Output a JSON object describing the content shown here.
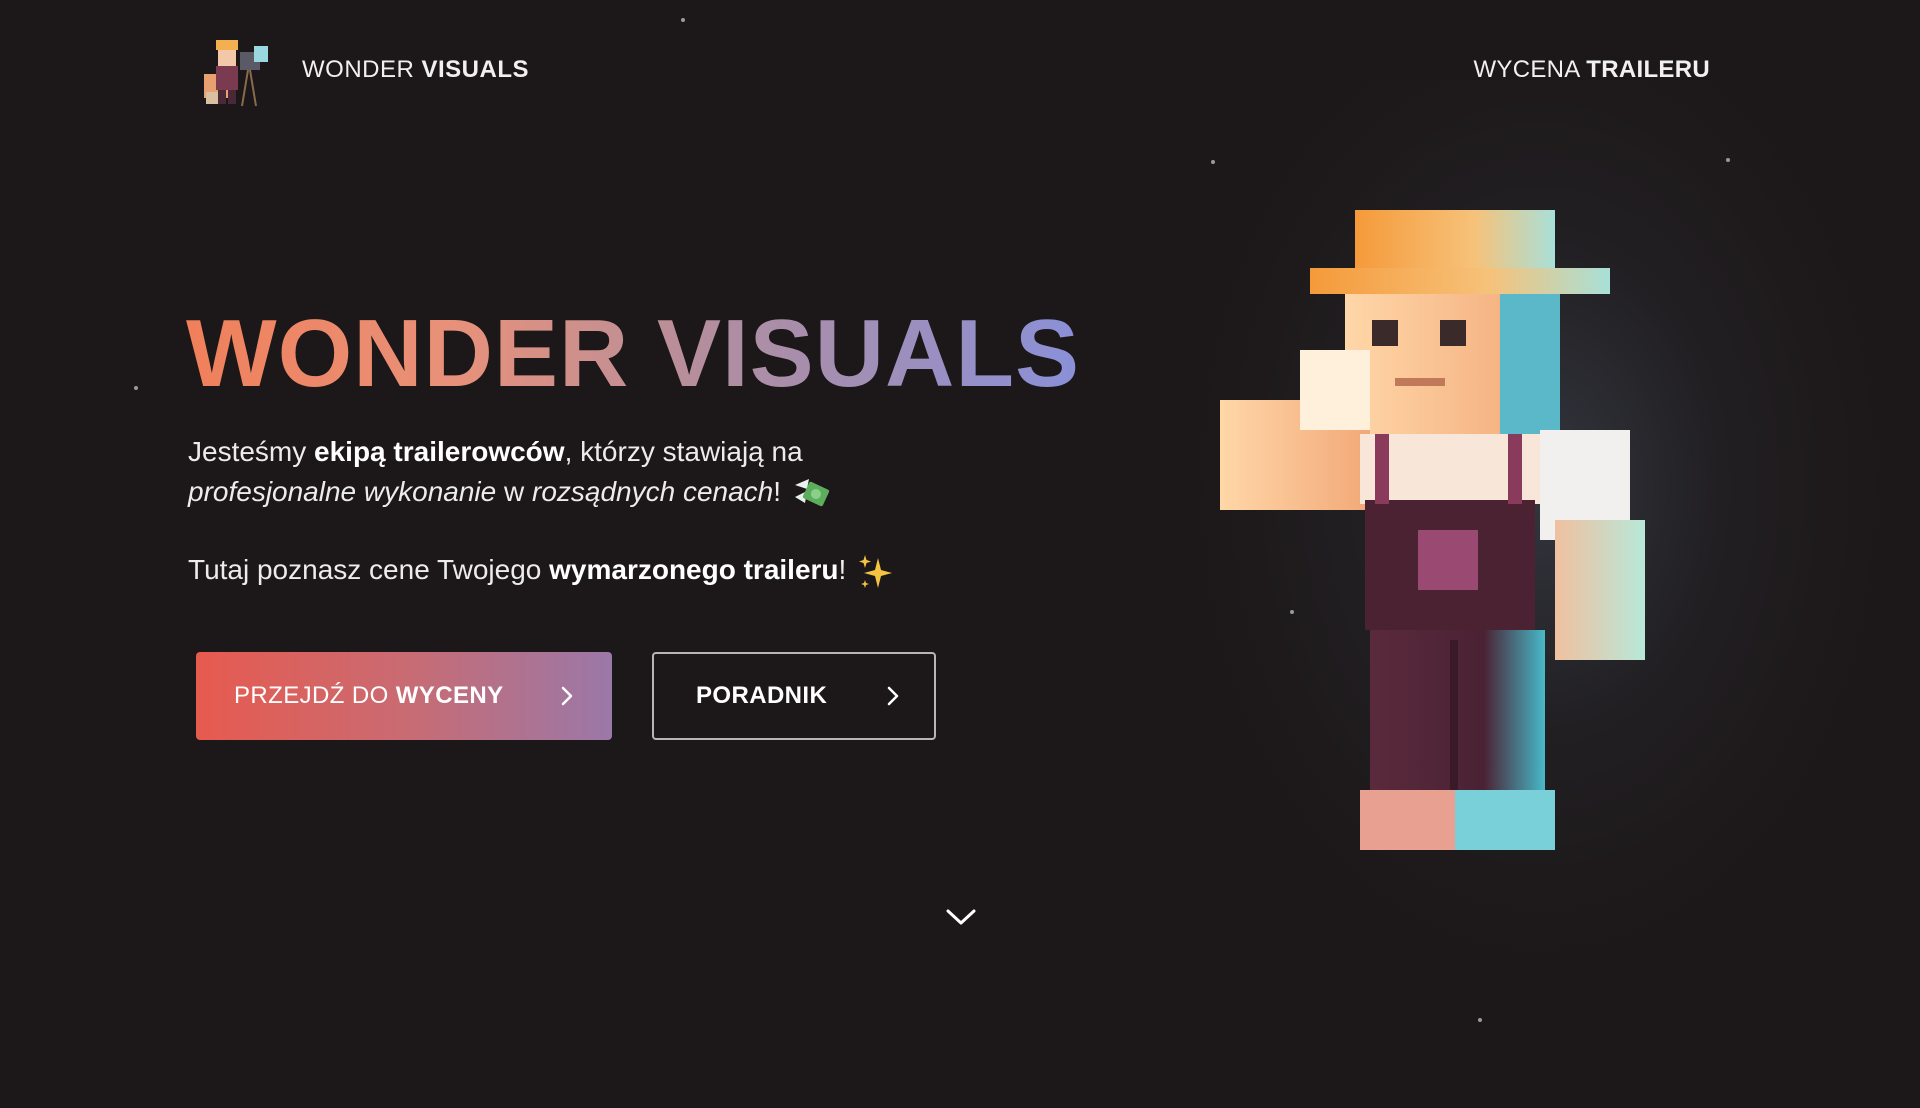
{
  "header": {
    "logo_word1": "WONDER",
    "logo_word2": "VISUALS",
    "nav_word1": "WYCENA",
    "nav_word2": "TRAILERU"
  },
  "hero": {
    "title": "WONDER VISUALS",
    "para1": {
      "t1": "Jesteśmy ",
      "b1": "ekipą trailerowców",
      "t2": ", którzy stawiają na",
      "i1": "profesjonalne wykonanie",
      "t3": " w ",
      "i2": "rozsądnych cenach",
      "t4": "!"
    },
    "para2": {
      "t1": "Tutaj poznasz cene Twojego ",
      "b1": "wymarzonego traileru",
      "t2": "!"
    }
  },
  "buttons": {
    "primary_word1": "PRZEJDŹ DO",
    "primary_word2": "WYCENY",
    "secondary": "PORADNIK"
  },
  "icons": {
    "logo": "cameraman-character-icon",
    "money": "money-with-wings-icon",
    "sparkles": "sparkles-icon",
    "chevron": "chevron-right-icon",
    "scroll": "chevron-down-icon"
  },
  "colors": {
    "background": "#1c1718",
    "title_gradient_start": "#f0805a",
    "title_gradient_end": "#8a90d8",
    "primary_btn_start": "#e75a4f",
    "primary_btn_end": "#9a78a8"
  }
}
